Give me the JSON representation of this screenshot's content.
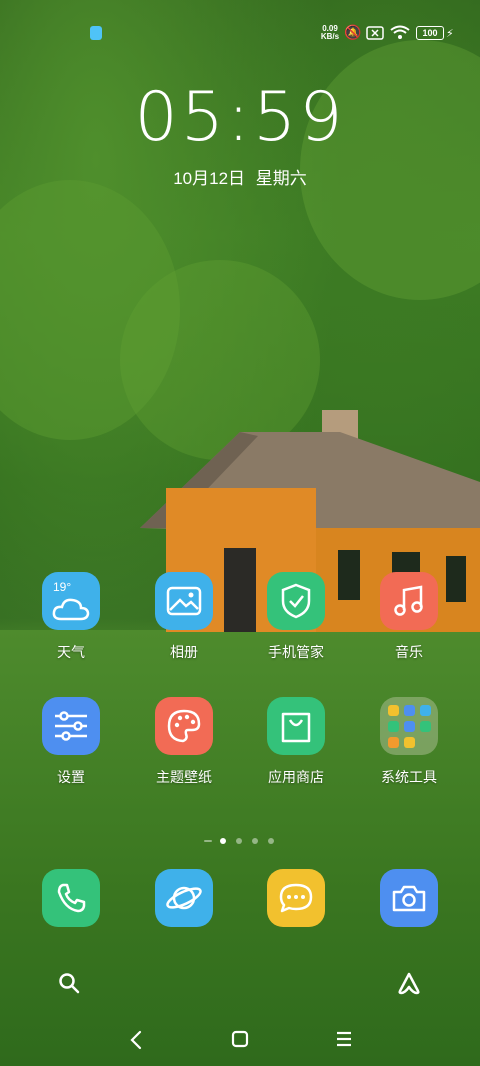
{
  "status_bar": {
    "net_speed_top": "0.09",
    "net_speed_bottom": "KB/s",
    "battery": "100"
  },
  "lockscreen": {
    "time": "05:59",
    "date": "10月12日",
    "weekday": "星期六"
  },
  "apps_row1": [
    {
      "label": "天气",
      "icon": "weather-icon",
      "temp": "19°",
      "color": "#3fb1ea"
    },
    {
      "label": "相册",
      "icon": "gallery-icon",
      "color": "#3fb1ea"
    },
    {
      "label": "手机管家",
      "icon": "shield-icon",
      "color": "#34c27a"
    },
    {
      "label": "音乐",
      "icon": "music-icon",
      "color": "#f26b55"
    }
  ],
  "apps_row2": [
    {
      "label": "设置",
      "icon": "settings-icon",
      "color": "#4e8ff0"
    },
    {
      "label": "主题壁纸",
      "icon": "palette-icon",
      "color": "#f26b55"
    },
    {
      "label": "应用商店",
      "icon": "store-bag-icon",
      "color": "#34c27a"
    },
    {
      "label": "系统工具",
      "icon": "folder-icon",
      "color": "rgba(220,220,200,0.35)"
    }
  ],
  "dock": [
    {
      "name": "phone",
      "icon": "phone-icon",
      "color": "#34c27a"
    },
    {
      "name": "browser",
      "icon": "planet-icon",
      "color": "#3fb1ea"
    },
    {
      "name": "messages",
      "icon": "chat-bubble-icon",
      "color": "#f2c12e"
    },
    {
      "name": "camera",
      "icon": "camera-icon",
      "color": "#4e8ff0"
    }
  ],
  "page_indicator": {
    "pages": 4,
    "active": 1
  },
  "nav": {
    "back": "back-icon",
    "home": "home-icon",
    "menu": "menu-icon"
  }
}
